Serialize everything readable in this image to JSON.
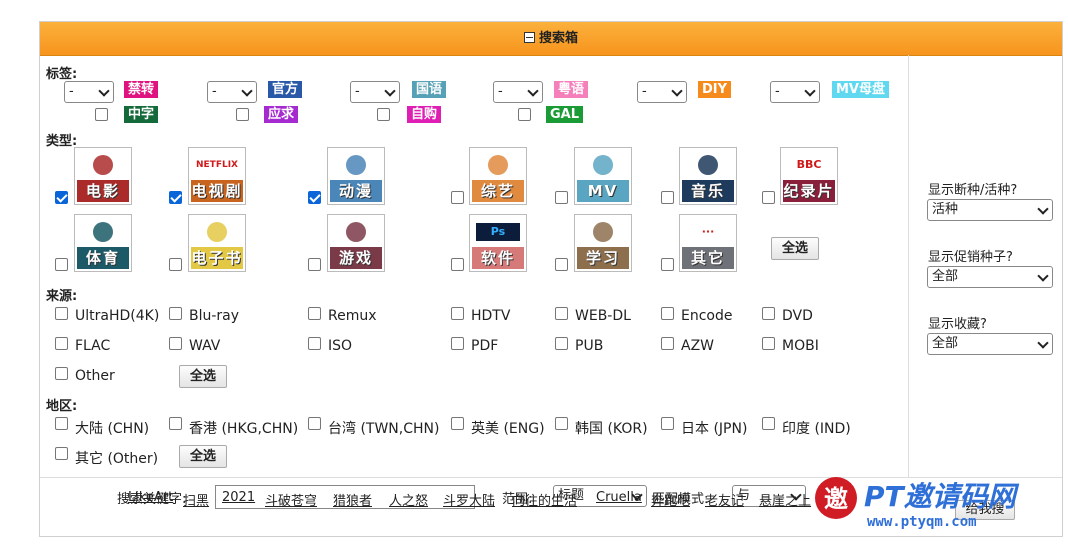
{
  "header": {
    "title": "搜索箱"
  },
  "tags_section": {
    "label": "标签:",
    "select_value": "-",
    "tags": [
      {
        "text": "禁转",
        "color": "#e0127f"
      },
      {
        "text": "官方",
        "color": "#2a58a8"
      },
      {
        "text": "国语",
        "color": "#56a1b6"
      },
      {
        "text": "粤语",
        "color": "#f57fbb"
      },
      {
        "text": "DIY",
        "color": "#f58b1d"
      },
      {
        "text": "MV母盘",
        "color": "#5fd8f0"
      },
      {
        "text": "中字",
        "color": "#156a3c"
      },
      {
        "text": "应求",
        "color": "#a52bd0"
      },
      {
        "text": "自购",
        "color": "#df1fb4"
      },
      {
        "text": "GAL",
        "color": "#1b9b36"
      }
    ]
  },
  "types_section": {
    "label": "类型:",
    "categories": [
      {
        "name": "电影",
        "bg": "#ab2b2b",
        "checked": true
      },
      {
        "name": "电视剧",
        "bg": "#c8641e",
        "checked": true,
        "badge": "NETFLIX"
      },
      {
        "name": "动漫",
        "bg": "#4b86b8",
        "checked": true
      },
      {
        "name": "综艺",
        "bg": "#e08a40",
        "checked": false
      },
      {
        "name": "MV",
        "bg": "#5aa6c2",
        "checked": false
      },
      {
        "name": "音乐",
        "bg": "#1e3a5c",
        "checked": false
      },
      {
        "name": "纪录片",
        "bg": "#8a1f3b",
        "checked": false,
        "badge": "BBC"
      },
      {
        "name": "体育",
        "bg": "#1b5a66",
        "checked": false
      },
      {
        "name": "电子书",
        "bg": "#e3c845",
        "checked": false
      },
      {
        "name": "游戏",
        "bg": "#7a3a48",
        "checked": false
      },
      {
        "name": "软件",
        "bg": "#d57979",
        "checked": false,
        "badge": "Ps"
      },
      {
        "name": "学习",
        "bg": "#8d6f4d",
        "checked": false
      },
      {
        "name": "其它",
        "bg": "#6f7178",
        "checked": false,
        "badge": "···"
      }
    ],
    "select_all": "全选"
  },
  "source_section": {
    "label": "来源:",
    "items": [
      "UltraHD(4K)",
      "Blu-ray",
      "Remux",
      "HDTV",
      "WEB-DL",
      "Encode",
      "DVD",
      "FLAC",
      "WAV",
      "ISO",
      "PDF",
      "PUB",
      "AZW",
      "MOBI",
      "Other"
    ],
    "select_all": "全选"
  },
  "region_section": {
    "label": "地区:",
    "items": [
      "大陆 (CHN)",
      "香港 (HKG,CHN)",
      "台湾 (TWN,CHN)",
      "英美 (ENG)",
      "韩国 (KOR)",
      "日本 (JPN)",
      "印度 (IND)",
      "其它 (Other)"
    ],
    "select_all": "全选"
  },
  "right_panel": {
    "seed_label": "显示断种/活种?",
    "seed_value": "活种",
    "promo_label": "显示促销种子?",
    "promo_value": "全部",
    "fav_label": "显示收藏?",
    "fav_value": "全部"
  },
  "search": {
    "keyword_label": "搜索关键字:",
    "keyword_value": "",
    "scope_label": "范围:",
    "scope_value": "标题",
    "match_label": "匹配模式:",
    "match_value": "与",
    "submit": "给我搜",
    "hot_keywords": [
      "LikeArt",
      "扫黑",
      "2021",
      "斗破苍穹",
      "猎狼者",
      "人之怒",
      "斗罗大陆",
      "向往的生活",
      "Cruella",
      "奔跑吧",
      "老友记",
      "悬崖之上"
    ]
  },
  "watermark": {
    "text": "PT邀请码网",
    "url": "www.ptyqm.com",
    "glyph": "邀"
  }
}
